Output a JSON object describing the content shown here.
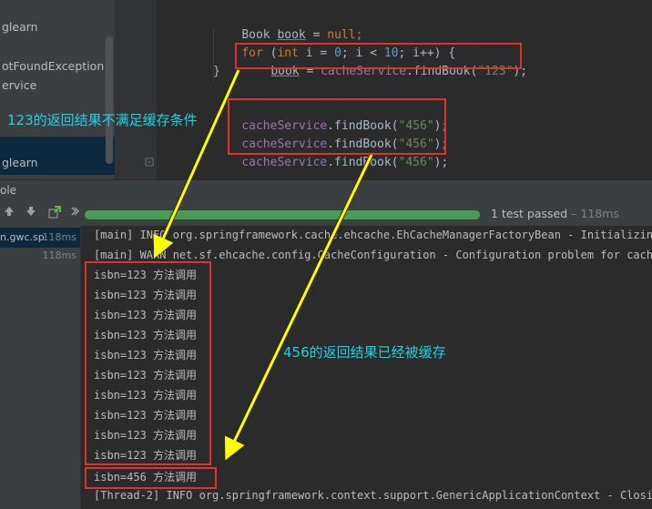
{
  "project_panel": {
    "items": [
      "glearn",
      "otFoundException",
      "ervice",
      "",
      "glearn"
    ]
  },
  "editor": {
    "lines": {
      "l1": {
        "type": "Book",
        "var": "book",
        "eq": " = ",
        "null": "null",
        "semi": ";"
      },
      "l2": {
        "for": "for",
        "open": " (",
        "int": "int",
        "rest1": " i = ",
        "zero": "0",
        "rest2": "; i < ",
        "ten": "10",
        "rest3": "; i++) {"
      },
      "l3": {
        "var": "book",
        "eq": " = ",
        "svc": "cacheService",
        "call": ".findBook(",
        "arg": "\"123\"",
        "close": ");"
      },
      "l4": {
        "text": "}"
      },
      "l5": {
        "svc": "cacheService",
        "call": ".findBook(",
        "arg": "\"456\"",
        "close": ");"
      },
      "l6": {
        "svc": "cacheService",
        "call": ".findBook(",
        "arg": "\"456\"",
        "close": ");"
      },
      "l7": {
        "svc": "cacheService",
        "call": ".findBook(",
        "arg": "\"456\"",
        "close": ");"
      }
    }
  },
  "run_panel": {
    "tab_label": "ole",
    "status": "1 test passed",
    "status_time": "– 118ms",
    "progress_fraction": 1.0,
    "colors": {
      "progress": "#499c54",
      "annotation": "#e0322e",
      "note": "#22d1e6",
      "arrow": "#ffff00"
    }
  },
  "test_tree": [
    {
      "name": "n.gwc.sp",
      "ms": "118ms"
    },
    {
      "name": "",
      "ms": "118ms"
    }
  ],
  "console": {
    "lines": [
      "[main] INFO org.springframework.cache.ehcache.EhCacheManagerFactoryBean - Initializing E",
      "[main] WARN net.sf.ehcache.config.CacheConfiguration - Configuration problem for cache b",
      "isbn=123 方法调用",
      "isbn=123 方法调用",
      "isbn=123 方法调用",
      "isbn=123 方法调用",
      "isbn=123 方法调用",
      "isbn=123 方法调用",
      "isbn=123 方法调用",
      "isbn=123 方法调用",
      "isbn=123 方法调用",
      "isbn=123 方法调用",
      "isbn=456 方法调用",
      "[Thread-2] INFO org.springframework.context.support.GenericApplicationContext - Closing"
    ]
  },
  "annotations": {
    "note_123": "123的返回结果不满足缓存条件",
    "note_456": "456的返回结果已经被缓存"
  }
}
